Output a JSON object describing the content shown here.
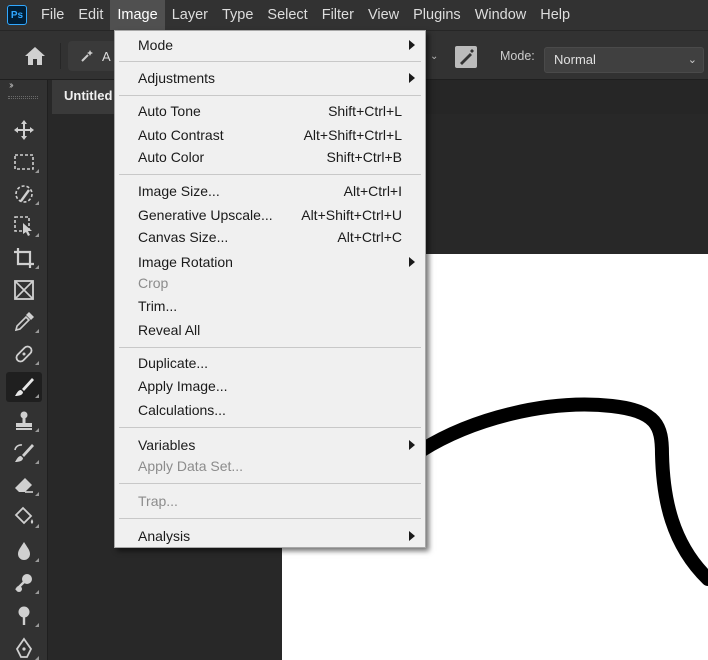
{
  "app": {
    "logo_text": "Ps"
  },
  "menubar": {
    "items": [
      "File",
      "Edit",
      "Image",
      "Layer",
      "Type",
      "Select",
      "Filter",
      "View",
      "Plugins",
      "Window",
      "Help"
    ],
    "active_index": 2
  },
  "options_bar": {
    "preset_text": "A",
    "mode_label": "Mode:",
    "mode_value": "Normal"
  },
  "document": {
    "tab_title": "Untitled"
  },
  "toolbar": {
    "tools": [
      "move-tool",
      "marquee-tool",
      "quick-selection-tool",
      "object-selection-tool",
      "crop-tool",
      "frame-tool",
      "eyedropper-tool",
      "healing-brush-tool",
      "brush-tool",
      "clone-stamp-tool",
      "history-brush-tool",
      "eraser-tool",
      "paint-bucket-tool",
      "blur-tool",
      "dodge-tool",
      "pen-tool"
    ],
    "active_tool": "brush-tool"
  },
  "image_menu": {
    "items": [
      {
        "label": "Mode",
        "submenu": true
      },
      {
        "label": "Adjustments",
        "submenu": true
      },
      {
        "label": "Auto Tone",
        "shortcut": "Shift+Ctrl+L"
      },
      {
        "label": "Auto Contrast",
        "shortcut": "Alt+Shift+Ctrl+L"
      },
      {
        "label": "Auto Color",
        "shortcut": "Shift+Ctrl+B"
      },
      {
        "label": "Image Size...",
        "shortcut": "Alt+Ctrl+I"
      },
      {
        "label": "Generative Upscale...",
        "shortcut": "Alt+Shift+Ctrl+U"
      },
      {
        "label": "Canvas Size...",
        "shortcut": "Alt+Ctrl+C"
      },
      {
        "label": "Image Rotation",
        "submenu": true
      },
      {
        "label": "Crop",
        "disabled": true
      },
      {
        "label": "Trim..."
      },
      {
        "label": "Reveal All"
      },
      {
        "label": "Duplicate..."
      },
      {
        "label": "Apply Image..."
      },
      {
        "label": "Calculations..."
      },
      {
        "label": "Variables",
        "submenu": true
      },
      {
        "label": "Apply Data Set...",
        "disabled": true
      },
      {
        "label": "Trap...",
        "disabled": true
      },
      {
        "label": "Analysis",
        "submenu": true
      }
    ]
  }
}
